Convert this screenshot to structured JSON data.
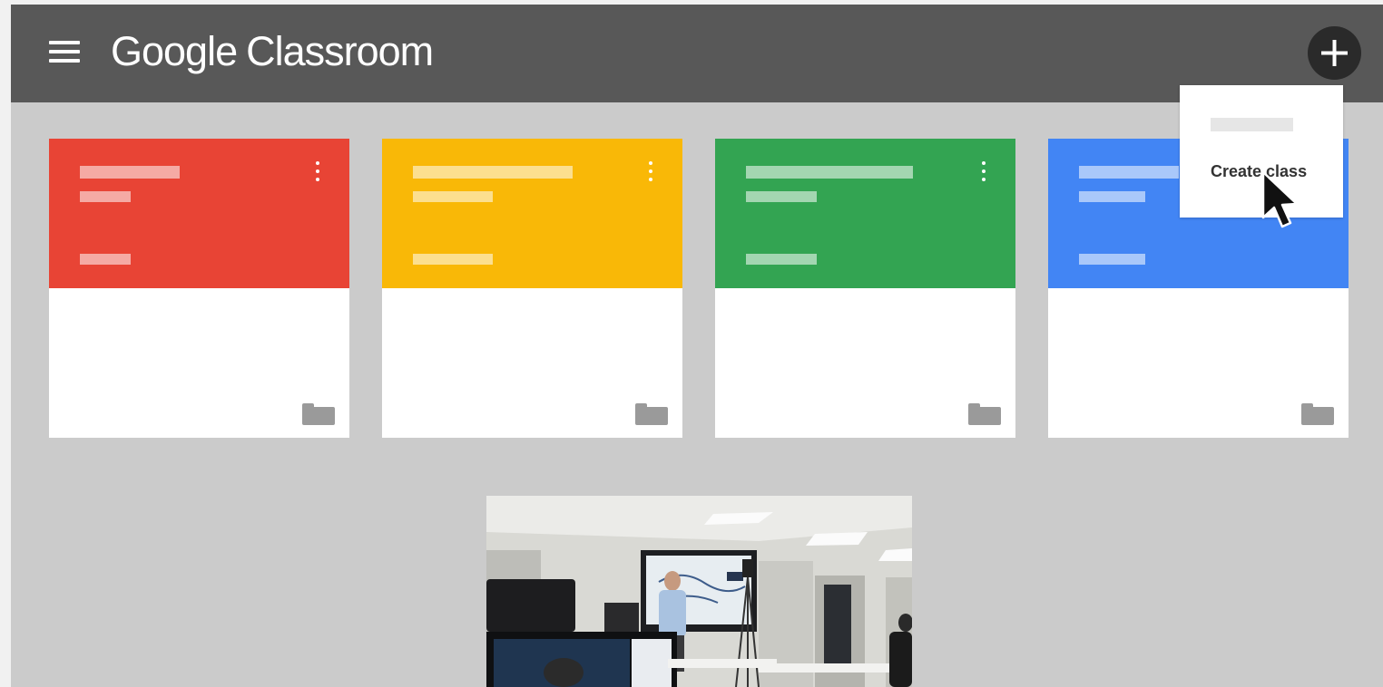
{
  "header": {
    "brand_google": "Google",
    "brand_product": "Classroom"
  },
  "add_menu": {
    "create_class_label": "Create class"
  },
  "classes": [
    {
      "color": "#e84435"
    },
    {
      "color": "#f9b807"
    },
    {
      "color": "#33a452"
    },
    {
      "color": "#4285f4"
    }
  ],
  "icons": {
    "menu": "hamburger-icon",
    "add": "plus-icon",
    "more": "kebab-icon",
    "folder": "folder-icon",
    "pointer": "cursor-arrow"
  }
}
